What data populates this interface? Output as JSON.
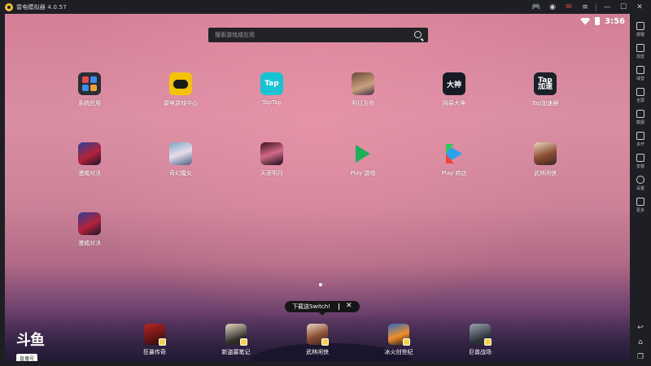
{
  "window": {
    "title": "雷电模拟器 4.0.57"
  },
  "status": {
    "time": "3:56"
  },
  "search": {
    "placeholder": "搜索游戏或应用"
  },
  "desktop": {
    "apps": [
      {
        "label": "系统应用",
        "icon": "folder-icon"
      },
      {
        "label": "雷电游戏中心",
        "icon": "gamepad-icon"
      },
      {
        "label": "TapTap",
        "icon": "taptap-icon",
        "icon_text": "Tap"
      },
      {
        "label": "明日方舟",
        "icon": "game-icon"
      },
      {
        "label": "网易大神",
        "icon": "dashen-icon",
        "icon_text": "大神"
      },
      {
        "label": "Tap加速器",
        "icon": "tap-accelerator-icon",
        "icon_text": "Tap\n加速"
      },
      {
        "label": "漫威对决",
        "icon": "game-icon"
      },
      {
        "label": "奇幻魔女",
        "icon": "game-icon"
      },
      {
        "label": "天涯明月",
        "icon": "game-icon"
      },
      {
        "label": "Play 游戏",
        "icon": "play-games-icon"
      },
      {
        "label": "Play 商店",
        "icon": "play-store-icon"
      },
      {
        "label": "武林闲侠",
        "icon": "game-icon"
      },
      {
        "label": "漫威对决",
        "icon": "game-icon"
      }
    ]
  },
  "tooltip": {
    "text": "下载送Switch!",
    "close": "✕"
  },
  "dock": {
    "apps": [
      {
        "label": "狂暴传奇"
      },
      {
        "label": "新盗墓笔记"
      },
      {
        "label": "武林闲侠"
      },
      {
        "label": "冰火创世纪"
      },
      {
        "label": "巨兽战场"
      }
    ]
  },
  "watermark": {
    "logo": "斗鱼",
    "tag": "直播号",
    "room": "5433079"
  },
  "sidebar": {
    "items": [
      {
        "label": "按键"
      },
      {
        "label": "加音"
      },
      {
        "label": "减音"
      },
      {
        "label": "全屏"
      },
      {
        "label": "截图"
      },
      {
        "label": "多开"
      },
      {
        "label": "安装"
      },
      {
        "label": "设置"
      },
      {
        "label": "更多"
      }
    ]
  },
  "colors": {
    "chrome": "#1e1f24",
    "wallpaper_top": "#d47f97",
    "wallpaper_bottom": "#2c2244",
    "search_bg": "#222326"
  }
}
